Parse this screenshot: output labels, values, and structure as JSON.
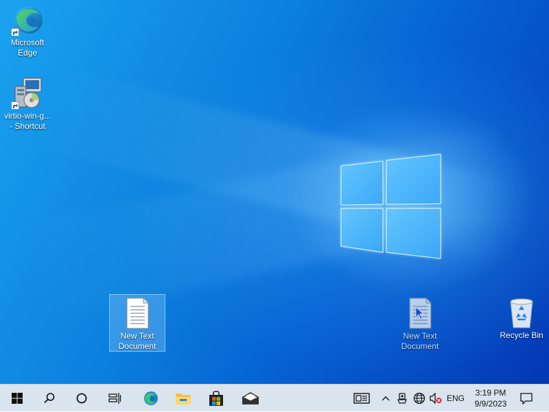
{
  "desktop": {
    "icons": [
      {
        "label_line1": "Microsoft",
        "label_line2": "Edge",
        "icon": "edge-icon"
      },
      {
        "label_line1": "virtio-win-g...",
        "label_line2": "- Shortcut",
        "icon": "installer-icon"
      },
      {
        "label_line1": "New Text",
        "label_line2": "Document",
        "icon": "text-document-icon",
        "selected": true
      },
      {
        "label_line1": "New Text",
        "label_line2": "Document",
        "icon": "text-document-icon"
      },
      {
        "label_line1": "Recycle Bin",
        "label_line2": "",
        "icon": "recycle-bin-icon"
      }
    ]
  },
  "taskbar": {
    "buttons": [
      "start-icon",
      "search-icon",
      "cortana-icon",
      "task-view-icon",
      "edge-icon",
      "file-explorer-icon",
      "microsoft-store-icon",
      "mail-icon"
    ],
    "tray": {
      "language": "ENG",
      "icons": [
        "news-icon",
        "chevron-up-icon",
        "meet-now-icon",
        "network-icon",
        "volume-muted-icon"
      ]
    },
    "clock": {
      "time": "3:19 PM",
      "date": "9/9/2023"
    },
    "notifications_icon": "notification-icon"
  },
  "colors": {
    "accent": "#0078d7",
    "taskbar_bg": "#d9e4ee"
  }
}
